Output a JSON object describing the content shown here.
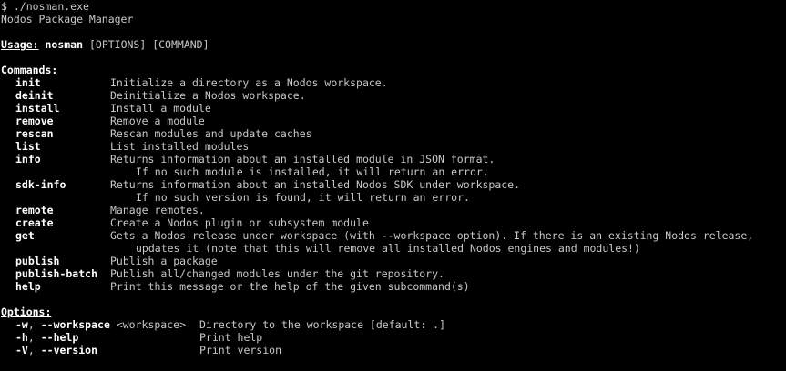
{
  "prompt": {
    "symbol": "$",
    "command": "./nosman.exe"
  },
  "program_title": "Nodos Package Manager",
  "usage": {
    "label": "Usage:",
    "program": "nosman",
    "args": "[OPTIONS] [COMMAND]"
  },
  "commands_header": "Commands:",
  "commands": [
    {
      "name": "init",
      "desc": "Initialize a directory as a Nodos workspace."
    },
    {
      "name": "deinit",
      "desc": "Deinitialize a Nodos workspace."
    },
    {
      "name": "install",
      "desc": "Install a module"
    },
    {
      "name": "remove",
      "desc": "Remove a module"
    },
    {
      "name": "rescan",
      "desc": "Rescan modules and update caches"
    },
    {
      "name": "list",
      "desc": "List installed modules"
    },
    {
      "name": "info",
      "desc": "Returns information about an installed module in JSON format.",
      "cont": "If no such module is installed, it will return an error."
    },
    {
      "name": "sdk-info",
      "desc": "Returns information about an installed Nodos SDK under workspace.",
      "cont": "If no such version is found, it will return an error."
    },
    {
      "name": "remote",
      "desc": "Manage remotes."
    },
    {
      "name": "create",
      "desc": "Create a Nodos plugin or subsystem module"
    },
    {
      "name": "get",
      "desc": "Gets a Nodos release under workspace (with --workspace option). If there is an existing Nodos release,",
      "cont": "updates it (note that this will remove all installed Nodos engines and modules!)"
    },
    {
      "name": "publish",
      "desc": "Publish a package"
    },
    {
      "name": "publish-batch",
      "desc": "Publish all/changed modules under the git repository."
    },
    {
      "name": "help",
      "desc": "Print this message or the help of the given subcommand(s)"
    }
  ],
  "options_header": "Options:",
  "options": [
    {
      "short": "-w",
      "sep": ", ",
      "long": "--workspace",
      "arg": "<workspace>",
      "desc": "Directory to the workspace [default: .]"
    },
    {
      "short": "-h",
      "sep": ", ",
      "long": "--help",
      "arg": "",
      "desc": "Print help"
    },
    {
      "short": "-V",
      "sep": ", ",
      "long": "--version",
      "arg": "",
      "desc": "Print version"
    }
  ]
}
